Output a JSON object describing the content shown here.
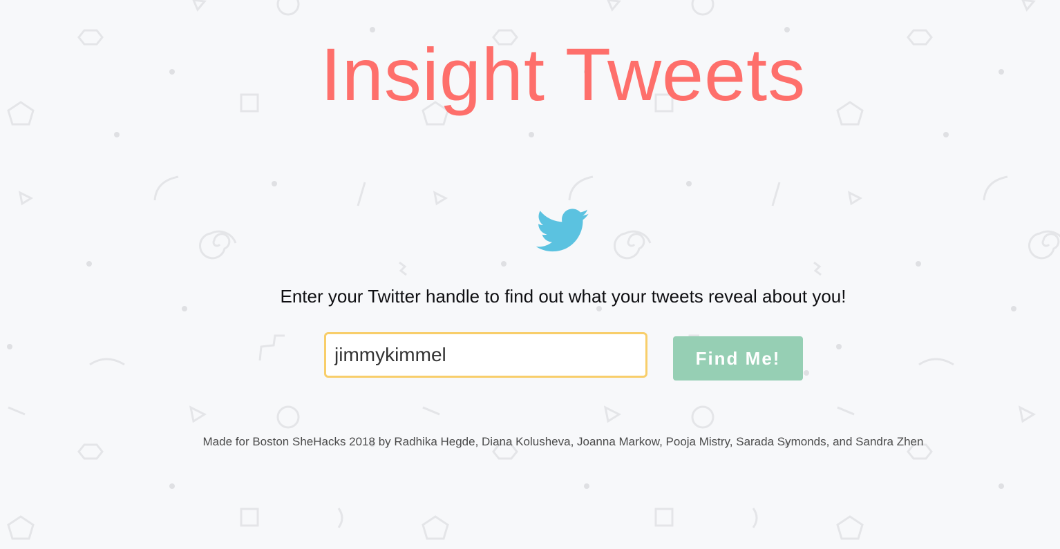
{
  "header": {
    "title": "Insight Tweets"
  },
  "logo": {
    "icon": "twitter-bird-icon",
    "color": "#5bc2e0"
  },
  "main": {
    "tagline": "Enter your Twitter handle to find out what your tweets reveal about you!",
    "handle_input": {
      "value": "jimmykimmel",
      "placeholder": ""
    },
    "find_button_label": "Find Me!"
  },
  "footer": {
    "credits": "Made for Boston SheHacks 2018 by Radhika Hegde, Diana Kolusheva, Joanna Markow, Pooja Mistry, Sarada Symonds, and Sandra Zhen"
  },
  "colors": {
    "background": "#f7f8fa",
    "title": "#fe6f6b",
    "input_border": "#f8ce6a",
    "button": "#96cfb4",
    "pattern": "#e4e5e8"
  }
}
